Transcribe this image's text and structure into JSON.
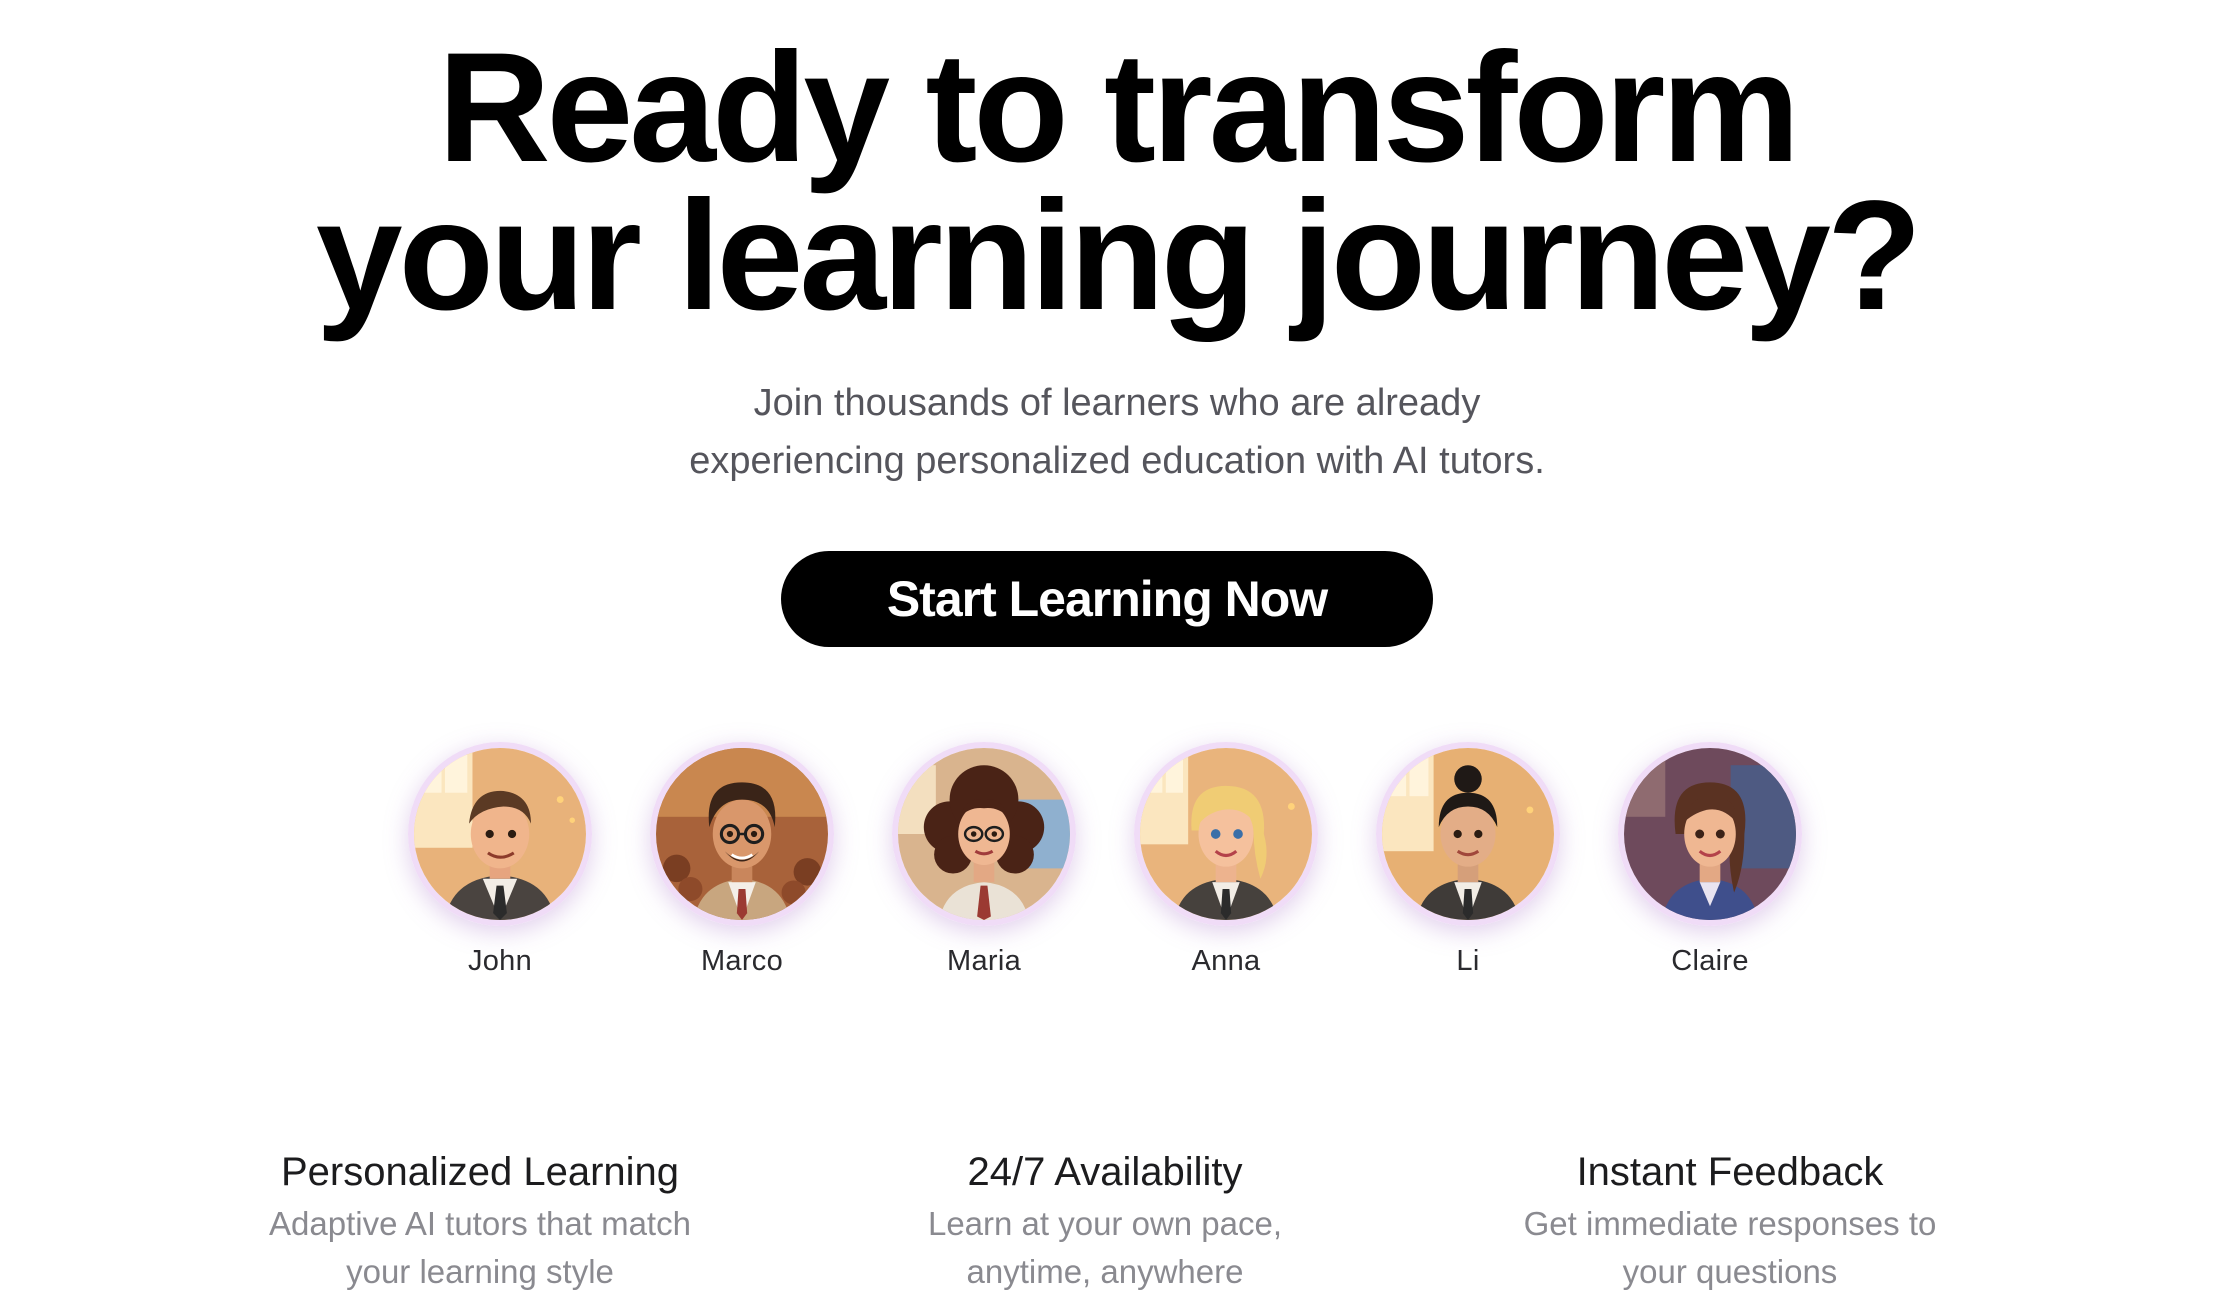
{
  "hero": {
    "headline_line1": "Ready to transform",
    "headline_line2": "your learning journey?",
    "subtitle_line1": "Join thousands of learners who are already",
    "subtitle_line2": "experiencing personalized education with AI tutors.",
    "cta_label": "Start Learning Now"
  },
  "tutors": [
    {
      "name": "John",
      "icon": "tutor-avatar-john"
    },
    {
      "name": "Marco",
      "icon": "tutor-avatar-marco"
    },
    {
      "name": "Maria",
      "icon": "tutor-avatar-maria"
    },
    {
      "name": "Anna",
      "icon": "tutor-avatar-anna"
    },
    {
      "name": "Li",
      "icon": "tutor-avatar-li"
    },
    {
      "name": "Claire",
      "icon": "tutor-avatar-claire"
    }
  ],
  "features": [
    {
      "title": "Personalized Learning",
      "desc_line1": "Adaptive AI tutors that match",
      "desc_line2": "your learning style"
    },
    {
      "title": "24/7 Availability",
      "desc_line1": "Learn at your own pace,",
      "desc_line2": "anytime, anywhere"
    },
    {
      "title": "Instant Feedback",
      "desc_line1": "Get immediate responses to",
      "desc_line2": "your questions"
    }
  ],
  "colors": {
    "cta_background": "#000000",
    "avatar_ring": "#f0dcf7",
    "subtitle_text": "#55555c",
    "feature_desc_text": "#8a8a90"
  }
}
